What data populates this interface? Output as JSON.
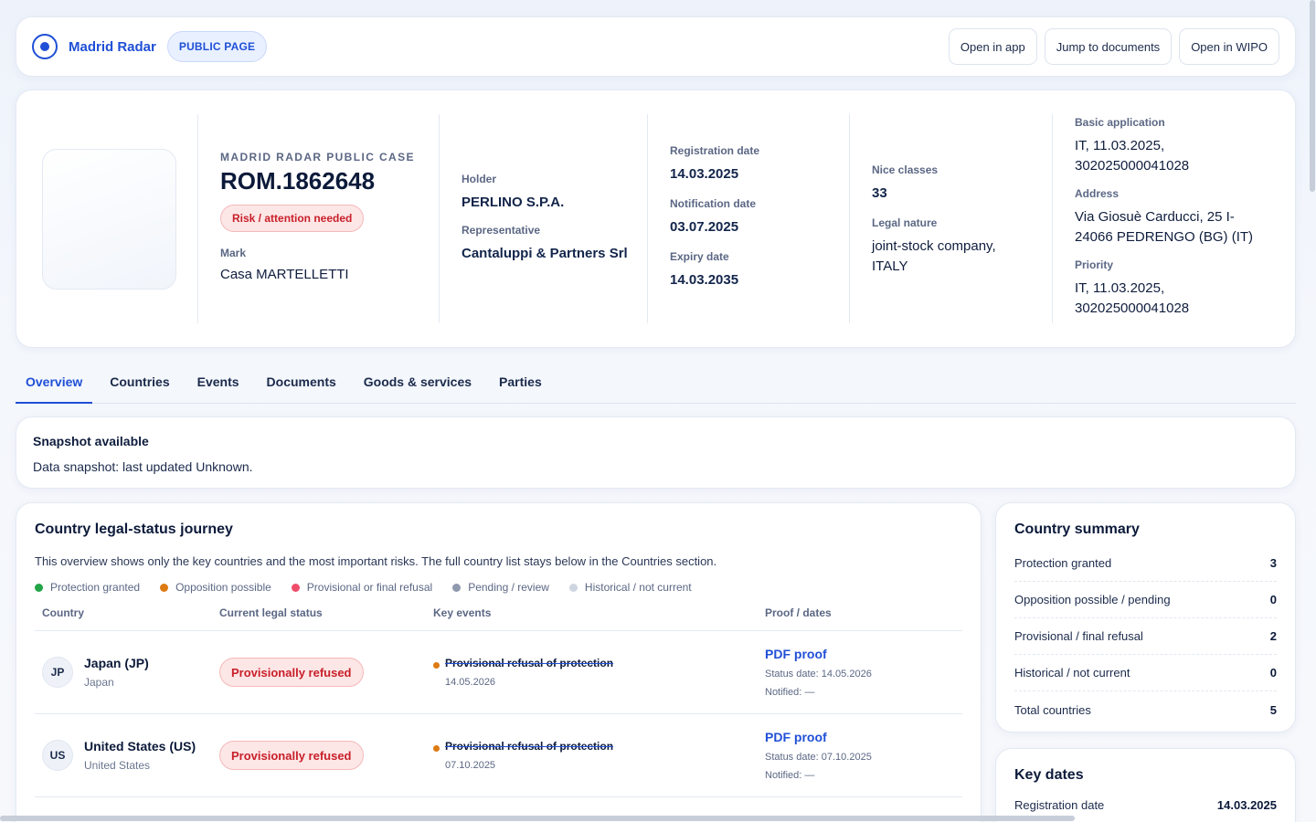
{
  "topbar": {
    "brand": "Madrid Radar",
    "badge": "PUBLIC PAGE",
    "actions": [
      "Open in app",
      "Jump to documents",
      "Open in WIPO"
    ]
  },
  "header": {
    "eyebrow": "MADRID RADAR PUBLIC CASE",
    "case_id": "ROM.1862648",
    "risk": "Risk / attention needed",
    "mark_label": "Mark",
    "mark_value": "Casa MARTELLETTI",
    "holder_label": "Holder",
    "holder_value": "PERLINO S.P.A.",
    "representative_label": "Representative",
    "representative_value": "Cantaluppi & Partners Srl",
    "registration_label": "Registration date",
    "registration_value": "14.03.2025",
    "notification_label": "Notification date",
    "notification_value": "03.07.2025",
    "expiry_label": "Expiry date",
    "expiry_value": "14.03.2035",
    "nice_label": "Nice classes",
    "nice_value": "33",
    "legal_label": "Legal nature",
    "legal_value": "joint-stock company, ITALY",
    "basic_label": "Basic application",
    "basic_value": "IT, 11.03.2025, 302025000041028",
    "address_label": "Address",
    "address_value": "Via Giosuè Carducci, 25 I-24066 PEDRENGO (BG) (IT)",
    "priority_label": "Priority",
    "priority_value": "IT, 11.03.2025, 302025000041028"
  },
  "tabs": [
    "Overview",
    "Countries",
    "Events",
    "Documents",
    "Goods & services",
    "Parties"
  ],
  "snapshot": {
    "title": "Snapshot available",
    "text": "Data snapshot: last updated Unknown."
  },
  "journey": {
    "title": "Country legal-status journey",
    "description": "This overview shows only the key countries and the most important risks. The full country list stays below in the Countries section.",
    "legend": [
      {
        "label": "Protection granted",
        "color": "#22a447"
      },
      {
        "label": "Opposition possible",
        "color": "#dd7a12"
      },
      {
        "label": "Provisional or final refusal",
        "color": "#ee4d6a"
      },
      {
        "label": "Pending / review",
        "color": "#8f99ae"
      },
      {
        "label": "Historical / not current",
        "color": "#cfd5e0"
      }
    ],
    "columns": [
      "Country",
      "Current legal status",
      "Key events",
      "Proof / dates"
    ],
    "rows": [
      {
        "code": "JP",
        "name": "Japan (JP)",
        "sub": "Japan",
        "status": "Provisionally refused",
        "event": "Provisional refusal of protection",
        "event_date": "14.05.2026",
        "proof": "PDF proof",
        "status_date": "Status date: 14.05.2026",
        "notified": "Notified: —"
      },
      {
        "code": "US",
        "name": "United States (US)",
        "sub": "United States",
        "status": "Provisionally refused",
        "event": "Provisional refusal of protection",
        "event_date": "07.10.2025",
        "proof": "PDF proof",
        "status_date": "Status date: 07.10.2025",
        "notified": "Notified: —"
      }
    ]
  },
  "summary": {
    "title": "Country summary",
    "rows": [
      {
        "label": "Protection granted",
        "value": "3"
      },
      {
        "label": "Opposition possible / pending",
        "value": "0"
      },
      {
        "label": "Provisional / final refusal",
        "value": "2"
      },
      {
        "label": "Historical / not current",
        "value": "0"
      },
      {
        "label": "Total countries",
        "value": "5"
      }
    ]
  },
  "key_dates": {
    "title": "Key dates",
    "rows": [
      {
        "label": "Registration date",
        "value": "14.03.2025"
      }
    ]
  }
}
